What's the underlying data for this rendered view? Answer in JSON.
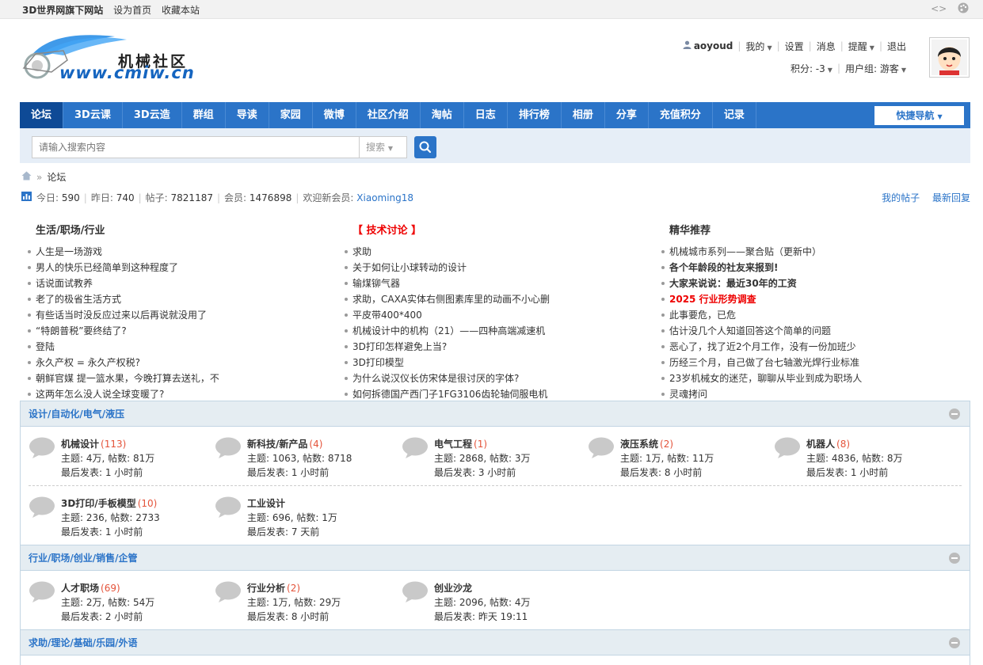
{
  "topbar": {
    "brand": "3D世界网旗下网站",
    "set_home": "设为首页",
    "bookmark": "收藏本站",
    "code_icon_text": "<>",
    "palette_icon": "palette-icon"
  },
  "logo": {
    "text_cn": "机械社区",
    "text_url": "www.cmiw.cn"
  },
  "user": {
    "username": "aoyoud",
    "mine": "我的",
    "settings": "设置",
    "messages": "消息",
    "reminders": "提醒",
    "logout": "退出",
    "points": "积分: -3",
    "usergroup": "用户组: 游客"
  },
  "nav": {
    "items": [
      "论坛",
      "3D云课",
      "3D云造",
      "群组",
      "导读",
      "家园",
      "微博",
      "社区介绍",
      "淘帖",
      "日志",
      "排行榜",
      "相册",
      "分享",
      "充值积分",
      "记录"
    ],
    "quick_nav": "快捷导航"
  },
  "search": {
    "placeholder": "请输入搜索内容",
    "type": "搜索"
  },
  "breadcrumb": {
    "current": "论坛"
  },
  "stats": {
    "today_label": "今日:",
    "today": "590",
    "yesterday_label": "昨日:",
    "yesterday": "740",
    "posts_label": "帖子:",
    "posts": "7821187",
    "members_label": "会员:",
    "members": "1476898",
    "welcome_label": "欢迎新会员:",
    "newest": "Xiaoming18",
    "my_posts": "我的帖子",
    "latest_replies": "最新回复"
  },
  "columns": [
    {
      "title": "生活/职场/行业",
      "title_style": "normal",
      "items": [
        {
          "text": "人生是一场游戏",
          "style": "normal"
        },
        {
          "text": "男人的快乐已经简单到这种程度了",
          "style": "normal"
        },
        {
          "text": "话说面试教养",
          "style": "normal"
        },
        {
          "text": "老了的极省生活方式",
          "style": "normal"
        },
        {
          "text": "有些话当时没反应过来以后再说就没用了",
          "style": "normal"
        },
        {
          "text": "“特朗普税”要终结了?",
          "style": "normal"
        },
        {
          "text": "登陆",
          "style": "normal"
        },
        {
          "text": "永久产权 = 永久产权税?",
          "style": "normal"
        },
        {
          "text": "朝鲜官媒 提一篮水果，今晚打算去送礼，不",
          "style": "normal"
        },
        {
          "text": "这两年怎么没人说全球变暖了?",
          "style": "normal"
        }
      ]
    },
    {
      "title": "【 技术讨论 】",
      "title_style": "red",
      "items": [
        {
          "text": "求助",
          "style": "normal"
        },
        {
          "text": "关于如何让小球转动的设计",
          "style": "normal"
        },
        {
          "text": "输煤铆气器",
          "style": "normal"
        },
        {
          "text": "求助，CAXA实体右侧图素库里的动画不小心删",
          "style": "normal"
        },
        {
          "text": "平皮带400*400",
          "style": "normal"
        },
        {
          "text": "机械设计中的机构（21）——四种高端减速机",
          "style": "normal"
        },
        {
          "text": "3D打印怎样避免上当?",
          "style": "normal"
        },
        {
          "text": "3D打印模型",
          "style": "normal"
        },
        {
          "text": "为什么说汉仪长仿宋体是很讨厌的字体?",
          "style": "normal"
        },
        {
          "text": "如何拆德国产西门子1FG3106齿轮轴伺服电机",
          "style": "normal"
        }
      ]
    },
    {
      "title": "精华推荐",
      "title_style": "normal",
      "items": [
        {
          "text": "机械城市系列——聚合贴（更新中）",
          "style": "normal"
        },
        {
          "text": "各个年龄段的社友来报到!",
          "style": "bold"
        },
        {
          "text": "大家来说说：最近30年的工资",
          "style": "bold"
        },
        {
          "text": "2025 行业形势调查",
          "style": "red"
        },
        {
          "text": "此事要危，已危",
          "style": "normal"
        },
        {
          "text": "估计没几个人知道回答这个简单的问题",
          "style": "normal"
        },
        {
          "text": "恶心了，找了近2个月工作，没有一份加班少",
          "style": "normal"
        },
        {
          "text": "历经三个月，自己做了台七轴激光焊行业标准",
          "style": "normal"
        },
        {
          "text": "23岁机械女的迷茫，聊聊从毕业到成为职场人",
          "style": "normal"
        },
        {
          "text": "灵魂拷问",
          "style": "normal"
        }
      ]
    }
  ],
  "sections": [
    {
      "title": "设计/自动化/电气/液压",
      "forums": [
        {
          "name": "机械设计",
          "new": "(113)",
          "stats": "主题: 4万, 帖数: 81万",
          "last": "最后发表: 1 小时前"
        },
        {
          "name": "新科技/新产品",
          "new": "(4)",
          "stats": "主题: 1063, 帖数: 8718",
          "last": "最后发表: 1 小时前"
        },
        {
          "name": "电气工程",
          "new": "(1)",
          "stats": "主题: 2868, 帖数: 3万",
          "last": "最后发表: 3 小时前"
        },
        {
          "name": "液压系统",
          "new": "(2)",
          "stats": "主题: 1万, 帖数: 11万",
          "last": "最后发表: 8 小时前"
        },
        {
          "name": "机器人",
          "new": "(8)",
          "stats": "主题: 4836, 帖数: 8万",
          "last": "最后发表: 1 小时前"
        },
        {
          "name": "3D打印/手板模型",
          "new": "(10)",
          "stats": "主题: 236, 帖数: 2733",
          "last": "最后发表: 1 小时前"
        },
        {
          "name": "工业设计",
          "new": "",
          "stats": "主题: 696, 帖数: 1万",
          "last": "最后发表: 7 天前"
        }
      ]
    },
    {
      "title": "行业/职场/创业/销售/企管",
      "forums": [
        {
          "name": "人才职场",
          "new": "(69)",
          "stats": "主题: 2万, 帖数: 54万",
          "last": "最后发表: 2 小时前"
        },
        {
          "name": "行业分析",
          "new": "(2)",
          "stats": "主题: 1万, 帖数: 29万",
          "last": "最后发表: 8 小时前"
        },
        {
          "name": "创业沙龙",
          "new": "",
          "stats": "主题: 2096, 帖数: 4万",
          "last": "最后发表: 昨天 19:11"
        }
      ]
    },
    {
      "title": "求助/理论/基础/乐园/外语",
      "forums": []
    }
  ],
  "colors": {
    "accent": "#2b74c8",
    "nav_active": "#0e4a96",
    "section_head": "#e5edf2",
    "count_red": "#e4533a",
    "hot_red": "#e00"
  }
}
